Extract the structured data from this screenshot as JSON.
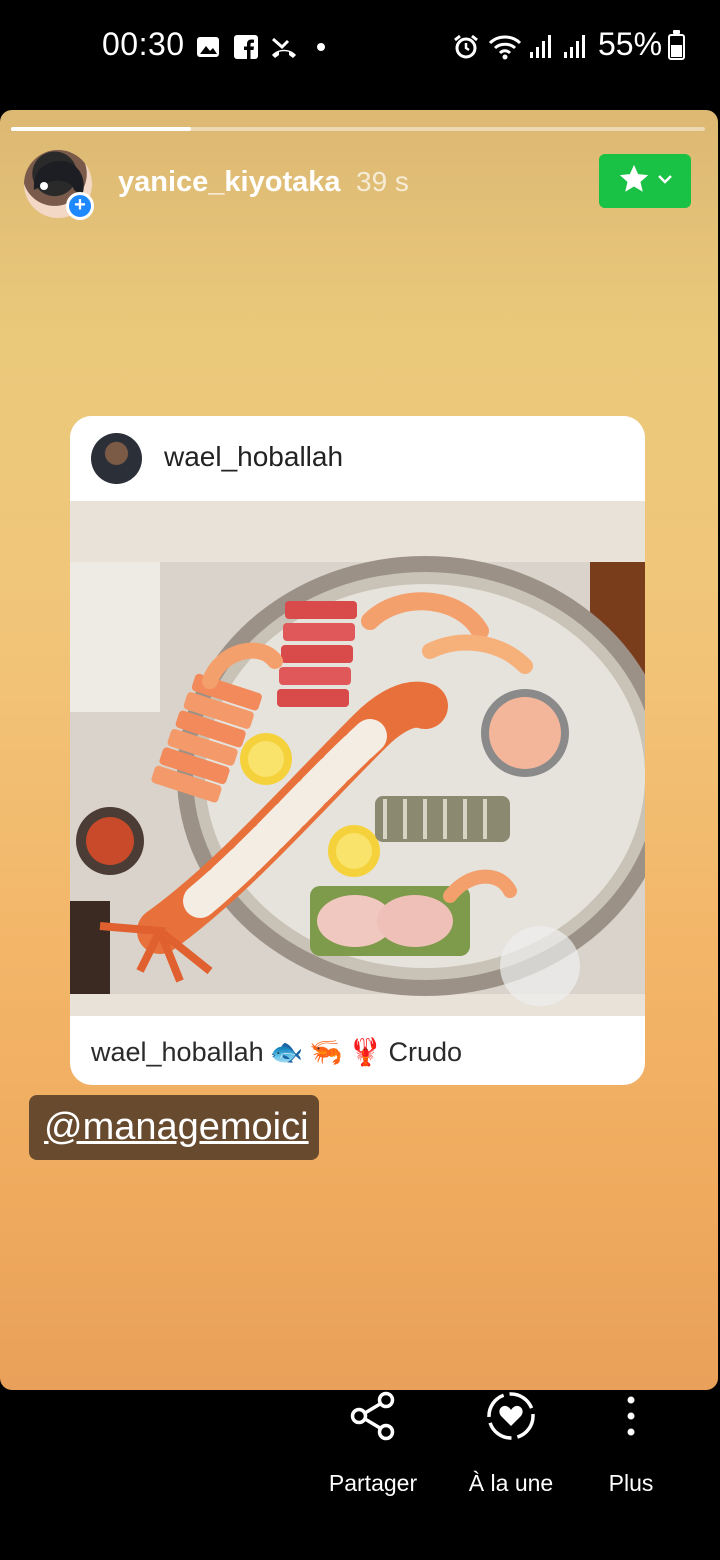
{
  "status_bar": {
    "time": "00:30",
    "battery_percent": "55%",
    "battery_level": 0.55,
    "icons": [
      "gallery-icon",
      "facebook-icon",
      "missed-call-icon",
      "notification-dot-icon",
      "alarm-icon",
      "wifi-icon",
      "signal-icon",
      "signal-icon",
      "battery-icon"
    ]
  },
  "story": {
    "progress": 0.26,
    "username": "yanice_kiyotaka",
    "time_ago": "39 s",
    "favorite_icon": "star-icon",
    "colors": {
      "favorite_button": "#19c145",
      "add_badge": "#1e88ff"
    }
  },
  "post": {
    "author": "wael_hoballah",
    "caption_user": "wael_hoballah",
    "caption_emojis": [
      "🐟",
      "🦐",
      "🦞"
    ],
    "caption_text": "Crudo"
  },
  "mention": {
    "text": "@managemoici"
  },
  "bottom_actions": [
    {
      "label": "Partager",
      "icon": "share-icon"
    },
    {
      "label": "À la une",
      "icon": "highlight-heart-icon"
    },
    {
      "label": "Plus",
      "icon": "more-vertical-icon"
    }
  ]
}
